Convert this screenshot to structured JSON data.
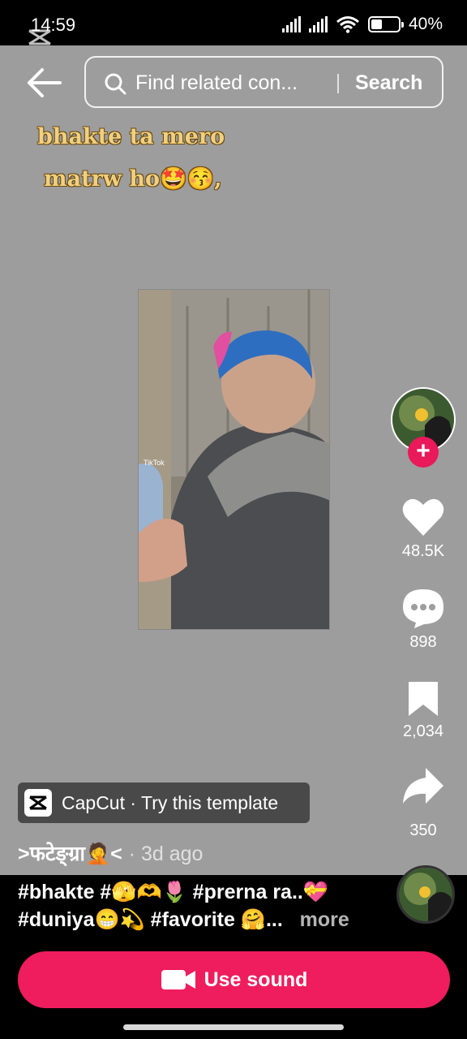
{
  "status_bar": {
    "time": "14:59",
    "battery": "40%",
    "battery_level": 0.4,
    "icons": [
      "capcut-icon",
      "signal-icon",
      "signal-icon",
      "wifi-icon",
      "battery-icon"
    ]
  },
  "search": {
    "placeholder": "Find related con...",
    "button_label": "Search"
  },
  "video": {
    "overlay_line1": "bhakte ta mero",
    "overlay_line2": "matrw ho🤩😚,",
    "watermark": "TikTok"
  },
  "actions": {
    "likes": "48.5K",
    "comments": "898",
    "bookmarks": "2,034",
    "shares": "350",
    "follow_symbol": "+"
  },
  "capcut": {
    "label": "CapCut · Try this template"
  },
  "author": {
    "name": ">फटेङ्ग्रा🤦<",
    "time": "· 3d ago"
  },
  "caption": {
    "line1": "#bhakte #🫣🫶🌷 #prerna ra..💝",
    "line2": "#duniya😁💫 #favorite 🤗...",
    "more": "more"
  },
  "sound": {
    "label": "Use sound"
  },
  "colors": {
    "accent": "#ef1d5d",
    "video_bg": "#9d9d9d",
    "overlay_text": "#f0d080"
  }
}
